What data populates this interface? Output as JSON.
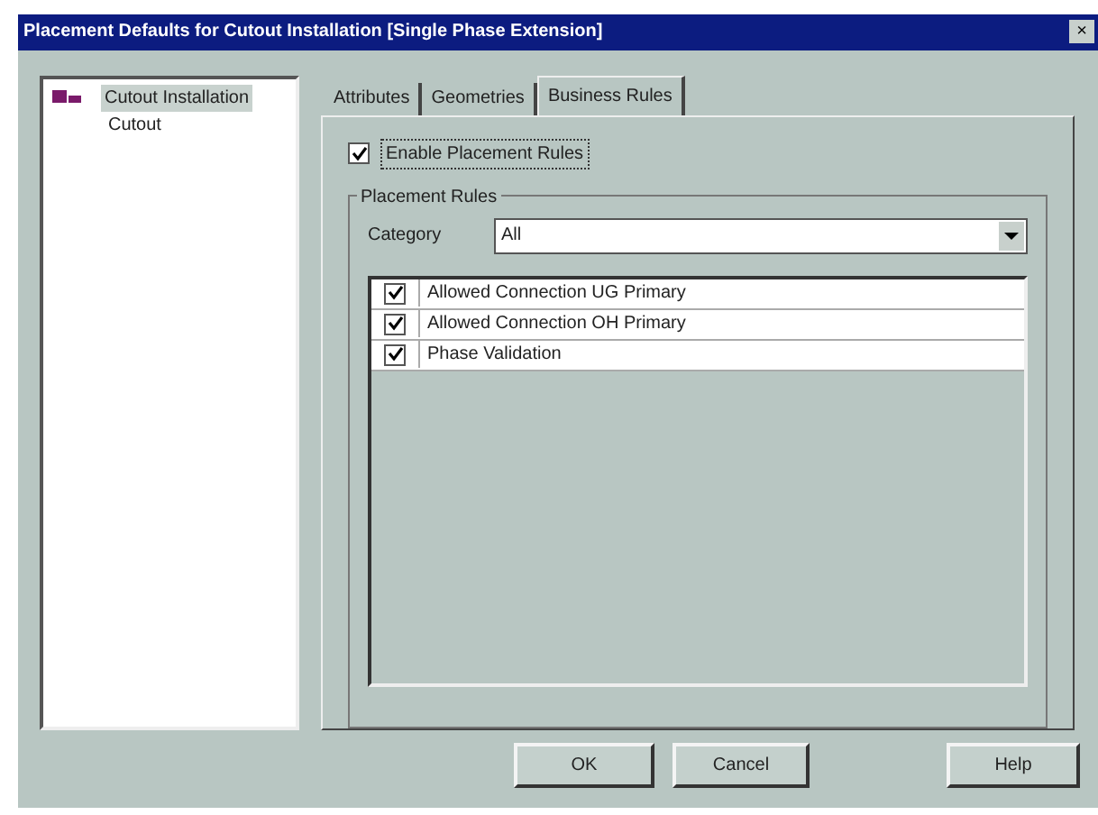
{
  "window": {
    "title": "Placement Defaults for Cutout Installation [Single Phase Extension]",
    "close": "×"
  },
  "tree": {
    "items": [
      {
        "label": "Cutout Installation",
        "selected": true,
        "kind": "parent"
      },
      {
        "label": "Cutout",
        "selected": false,
        "kind": "child"
      }
    ]
  },
  "tabs": [
    {
      "label": "Attributes",
      "selected": false
    },
    {
      "label": "Geometries",
      "selected": false
    },
    {
      "label": "Business Rules",
      "selected": true
    }
  ],
  "enable_rules": {
    "label": "Enable Placement Rules",
    "checked": true
  },
  "placement_rules": {
    "title": "Placement Rules",
    "category_label": "Category",
    "category_value": "All",
    "rules": [
      {
        "label": "Allowed Connection UG Primary",
        "checked": true
      },
      {
        "label": "Allowed Connection OH Primary",
        "checked": true
      },
      {
        "label": "Phase Validation",
        "checked": true
      }
    ]
  },
  "buttons": [
    "OK",
    "Cancel",
    "Help"
  ]
}
